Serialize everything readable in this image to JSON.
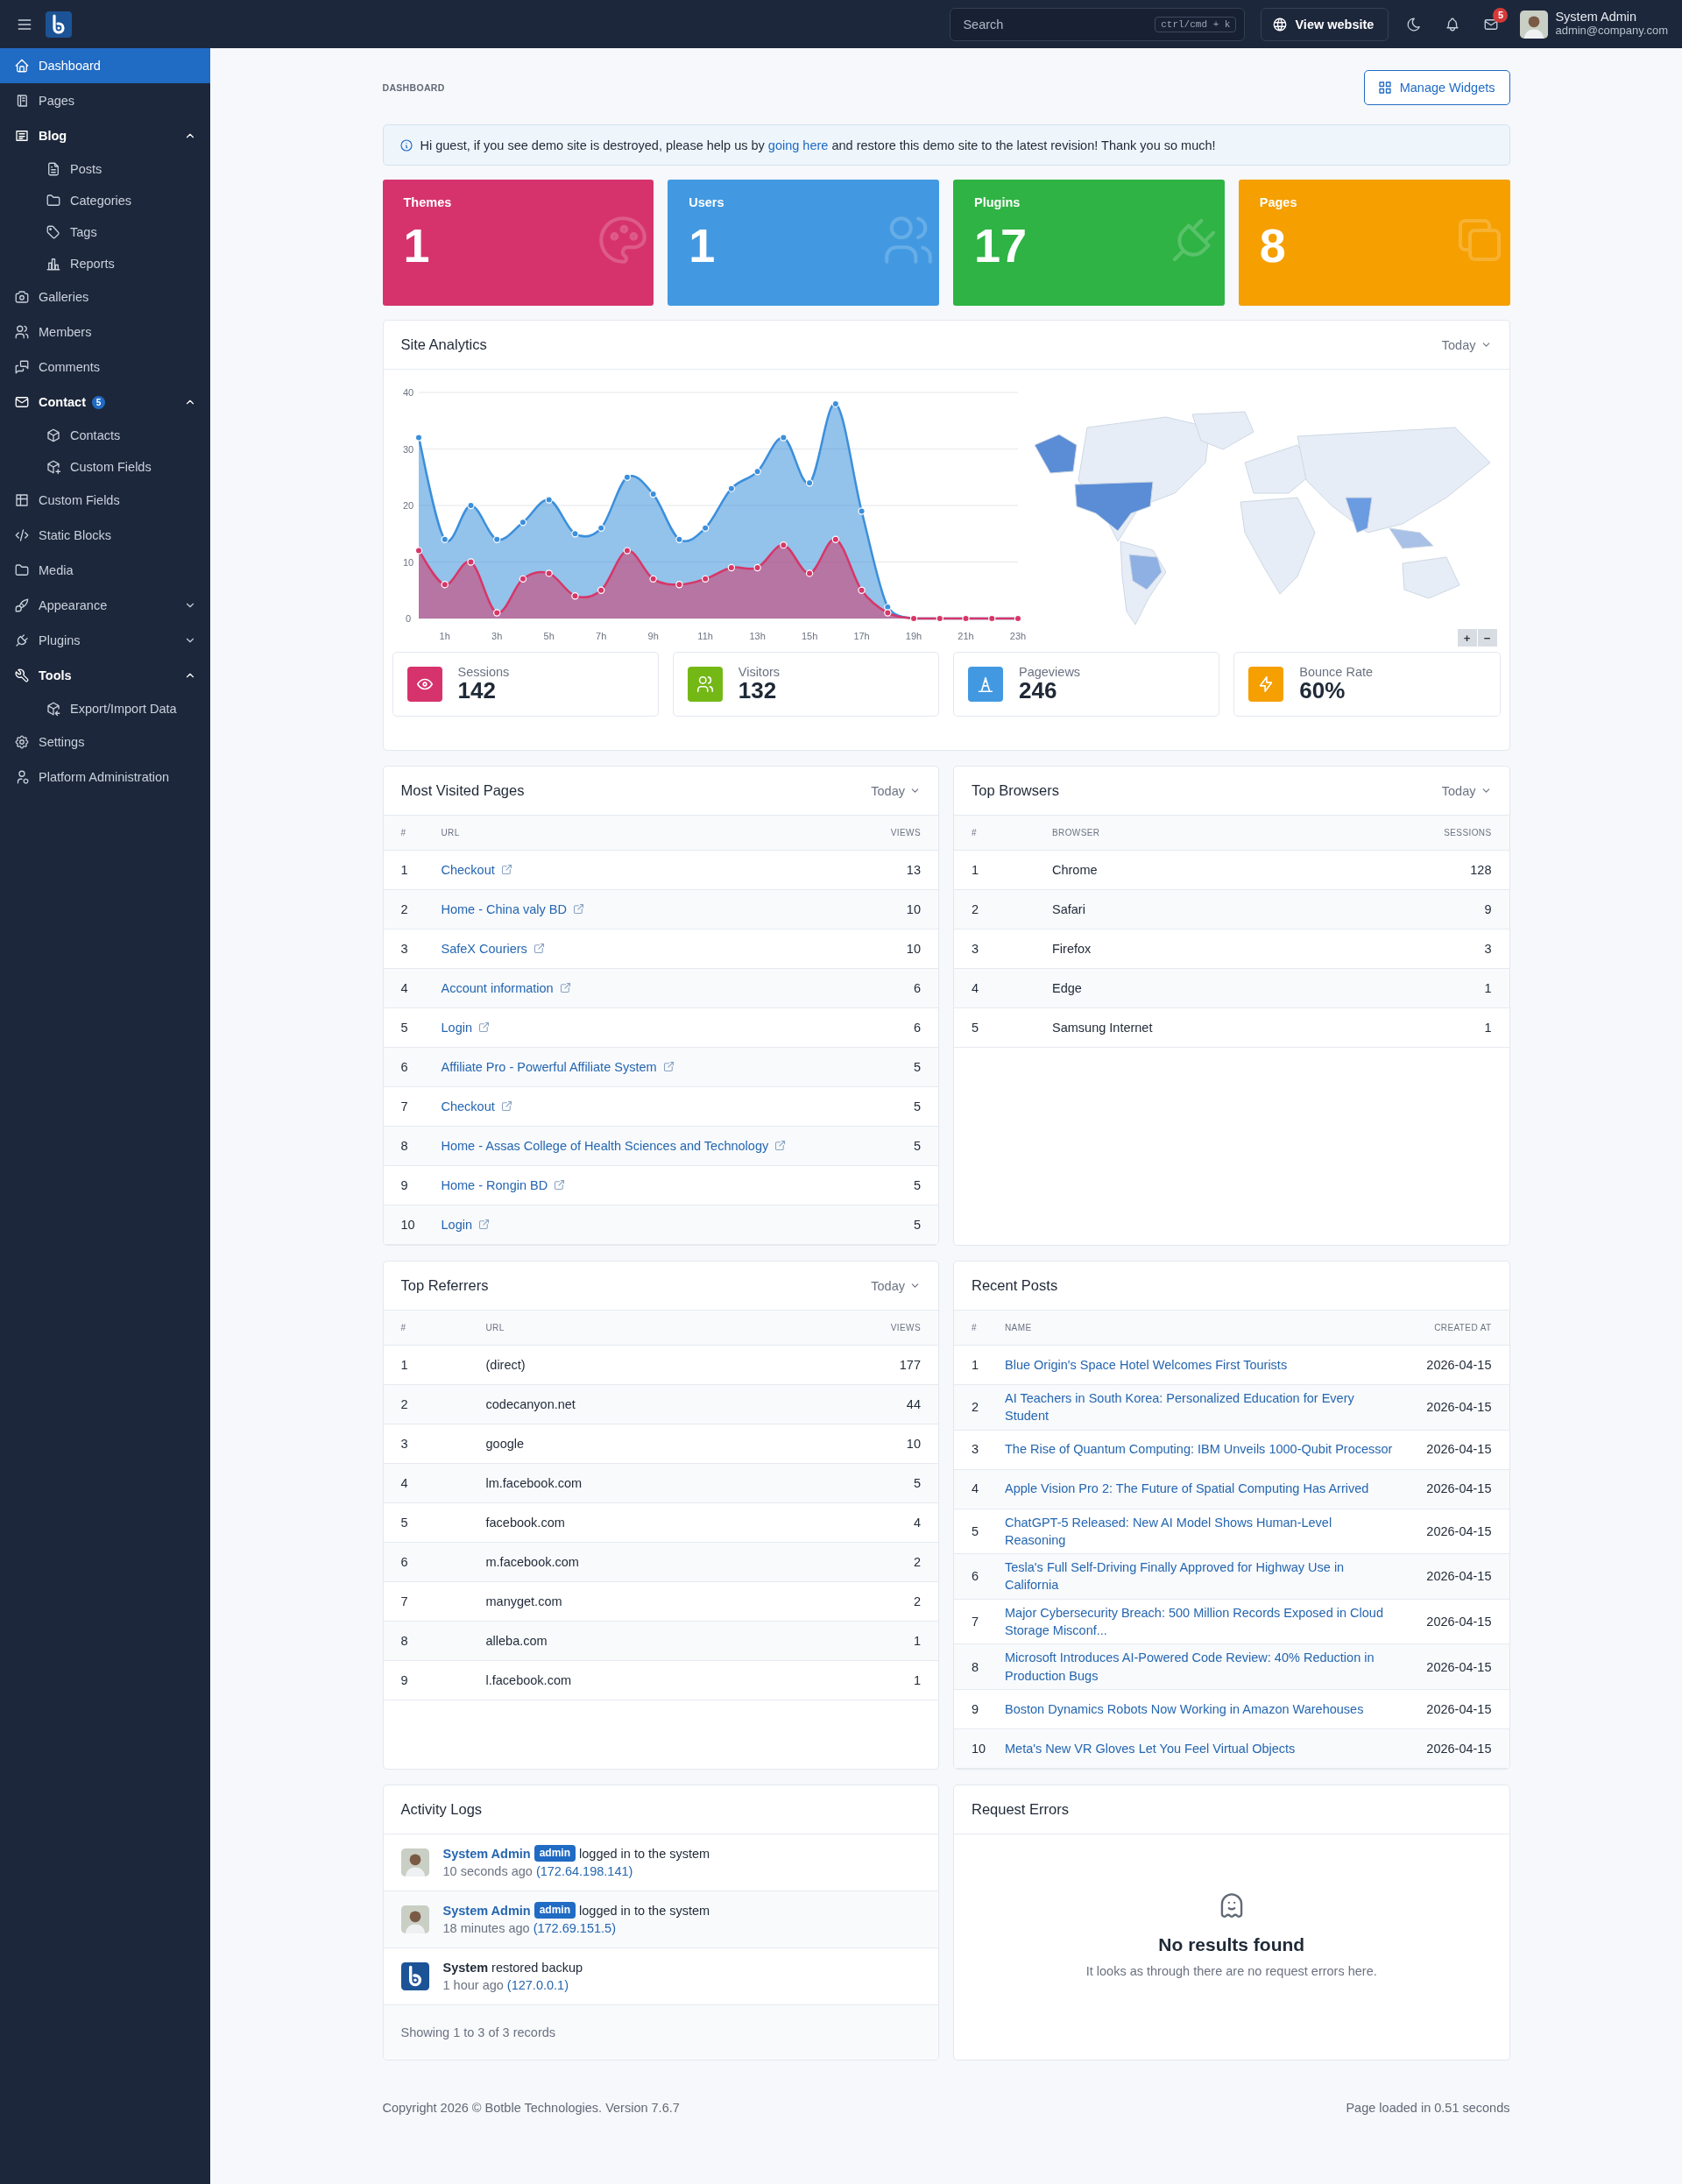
{
  "topbar": {
    "search": {
      "placeholder": "Search",
      "shortcut": "ctrl/cmd + k"
    },
    "view_website": "View website",
    "mail_badge": "5",
    "user": {
      "name": "System Admin",
      "email": "admin@company.com"
    }
  },
  "sidebar": {
    "items": [
      {
        "label": "Dashboard",
        "selected": true
      },
      {
        "label": "Pages",
        "selected": false
      },
      {
        "label": "Blog",
        "selected": false,
        "expanded": true,
        "children": [
          {
            "label": "Posts",
            "selected": false
          },
          {
            "label": "Categories",
            "selected": false
          },
          {
            "label": "Tags",
            "selected": false
          },
          {
            "label": "Reports",
            "selected": false
          }
        ]
      },
      {
        "label": "Galleries",
        "selected": false
      },
      {
        "label": "Members",
        "selected": false
      },
      {
        "label": "Comments",
        "selected": false
      },
      {
        "label": "Contact",
        "selected": false,
        "badge": "5",
        "expanded": true,
        "children": [
          {
            "label": "Contacts",
            "selected": false
          },
          {
            "label": "Custom Fields",
            "selected": false
          }
        ]
      },
      {
        "label": "Custom Fields",
        "selected": false
      },
      {
        "label": "Static Blocks",
        "selected": false
      },
      {
        "label": "Media",
        "selected": false
      },
      {
        "label": "Appearance",
        "selected": false,
        "expanded": false
      },
      {
        "label": "Plugins",
        "selected": false,
        "expanded": false
      },
      {
        "label": "Tools",
        "selected": false,
        "expanded": true,
        "children": [
          {
            "label": "Export/Import Data",
            "selected": false
          }
        ]
      },
      {
        "label": "Settings",
        "selected": false
      },
      {
        "label": "Platform Administration",
        "selected": false
      }
    ]
  },
  "page": {
    "breadcrumb": "DASHBOARD",
    "manage_widgets": "Manage Widgets"
  },
  "alert": {
    "before": "Hi guest, if you see demo site is destroyed, please help us by ",
    "link": "going here",
    "after": " and restore this demo site to the latest revision! Thank you so much!"
  },
  "stat_cards": [
    {
      "label": "Themes",
      "value": "1",
      "color": "#d6336c"
    },
    {
      "label": "Users",
      "value": "1",
      "color": "#4299e1"
    },
    {
      "label": "Plugins",
      "value": "17",
      "color": "#2fb344"
    },
    {
      "label": "Pages",
      "value": "8",
      "color": "#f59f00"
    }
  ],
  "site_analytics": {
    "title": "Site Analytics",
    "period": "Today",
    "chart_data": {
      "type": "area",
      "x": [
        0,
        1,
        2,
        3,
        4,
        5,
        6,
        7,
        8,
        9,
        10,
        11,
        12,
        13,
        14,
        15,
        16,
        17,
        18,
        19,
        20,
        21,
        22,
        23
      ],
      "xticks": [
        {
          "value": 1,
          "label": "1h"
        },
        {
          "value": 3,
          "label": "3h"
        },
        {
          "value": 5,
          "label": "5h"
        },
        {
          "value": 7,
          "label": "7h"
        },
        {
          "value": 9,
          "label": "9h"
        },
        {
          "value": 11,
          "label": "11h"
        },
        {
          "value": 13,
          "label": "13h"
        },
        {
          "value": 15,
          "label": "15h"
        },
        {
          "value": 17,
          "label": "17h"
        },
        {
          "value": 19,
          "label": "19h"
        },
        {
          "value": 21,
          "label": "21h"
        },
        {
          "value": 23,
          "label": "23h"
        }
      ],
      "xlim": [
        0,
        23
      ],
      "grid": true,
      "ylim": [
        0,
        40
      ],
      "yticks": [
        0,
        10,
        20,
        30,
        40
      ],
      "series": [
        {
          "color": "#3b8fdb",
          "values": [
            32,
            14,
            20,
            14,
            17,
            21,
            15,
            16,
            25,
            22,
            14,
            16,
            23,
            26,
            32,
            24,
            38,
            19,
            2,
            0,
            0,
            0,
            0,
            0
          ]
        },
        {
          "color": "#d63768",
          "values": [
            12,
            6,
            10,
            1,
            7,
            8,
            4,
            5,
            12,
            7,
            6,
            7,
            9,
            9,
            13,
            8,
            14,
            5,
            1,
            0,
            0,
            0,
            0,
            0
          ]
        }
      ]
    },
    "map": {
      "zoom_in": "+",
      "zoom_out": "−"
    },
    "metrics": [
      {
        "label": "Sessions",
        "value": "142",
        "color": "#d6336c"
      },
      {
        "label": "Visitors",
        "value": "132",
        "color": "#74b816"
      },
      {
        "label": "Pageviews",
        "value": "246",
        "color": "#4299e1"
      },
      {
        "label": "Bounce Rate",
        "value": "60%",
        "color": "#f59f00"
      }
    ]
  },
  "most_visited_pages": {
    "title": "Most Visited Pages",
    "period": "Today",
    "columns": [
      "#",
      "URL",
      "VIEWS"
    ],
    "rows": [
      {
        "rank": "1",
        "url": "Checkout",
        "views": "13"
      },
      {
        "rank": "2",
        "url": "Home - China valy BD",
        "views": "10"
      },
      {
        "rank": "3",
        "url": "SafeX Couriers",
        "views": "10"
      },
      {
        "rank": "4",
        "url": "Account information",
        "views": "6"
      },
      {
        "rank": "5",
        "url": "Login",
        "views": "6"
      },
      {
        "rank": "6",
        "url": "Affiliate Pro - Powerful Affiliate System",
        "views": "5"
      },
      {
        "rank": "7",
        "url": "Checkout",
        "views": "5"
      },
      {
        "rank": "8",
        "url": "Home - Assas College of Health Sciences and Technology",
        "views": "5"
      },
      {
        "rank": "9",
        "url": "Home - Rongin BD",
        "views": "5"
      },
      {
        "rank": "10",
        "url": "Login",
        "views": "5"
      }
    ]
  },
  "top_browsers": {
    "title": "Top Browsers",
    "period": "Today",
    "columns": [
      "#",
      "BROWSER",
      "SESSIONS"
    ],
    "rows": [
      {
        "rank": "1",
        "browser": "Chrome",
        "sessions": "128"
      },
      {
        "rank": "2",
        "browser": "Safari",
        "sessions": "9"
      },
      {
        "rank": "3",
        "browser": "Firefox",
        "sessions": "3"
      },
      {
        "rank": "4",
        "browser": "Edge",
        "sessions": "1"
      },
      {
        "rank": "5",
        "browser": "Samsung Internet",
        "sessions": "1"
      }
    ]
  },
  "top_referrers": {
    "title": "Top Referrers",
    "period": "Today",
    "columns": [
      "#",
      "URL",
      "VIEWS"
    ],
    "rows": [
      {
        "rank": "1",
        "url": "(direct)",
        "views": "177"
      },
      {
        "rank": "2",
        "url": "codecanyon.net",
        "views": "44"
      },
      {
        "rank": "3",
        "url": "google",
        "views": "10"
      },
      {
        "rank": "4",
        "url": "lm.facebook.com",
        "views": "5"
      },
      {
        "rank": "5",
        "url": "facebook.com",
        "views": "4"
      },
      {
        "rank": "6",
        "url": "m.facebook.com",
        "views": "2"
      },
      {
        "rank": "7",
        "url": "manyget.com",
        "views": "2"
      },
      {
        "rank": "8",
        "url": "alleba.com",
        "views": "1"
      },
      {
        "rank": "9",
        "url": "l.facebook.com",
        "views": "1"
      }
    ]
  },
  "recent_posts": {
    "title": "Recent Posts",
    "columns": [
      "#",
      "NAME",
      "CREATED AT"
    ],
    "rows": [
      {
        "rank": "1",
        "name": "Blue Origin's Space Hotel Welcomes First Tourists",
        "created_at": "2026-04-15"
      },
      {
        "rank": "2",
        "name": "AI Teachers in South Korea: Personalized Education for Every Student",
        "created_at": "2026-04-15"
      },
      {
        "rank": "3",
        "name": "The Rise of Quantum Computing: IBM Unveils 1000-Qubit Processor",
        "created_at": "2026-04-15"
      },
      {
        "rank": "4",
        "name": "Apple Vision Pro 2: The Future of Spatial Computing Has Arrived",
        "created_at": "2026-04-15"
      },
      {
        "rank": "5",
        "name": "ChatGPT-5 Released: New AI Model Shows Human-Level Reasoning",
        "created_at": "2026-04-15"
      },
      {
        "rank": "6",
        "name": "Tesla's Full Self-Driving Finally Approved for Highway Use in California",
        "created_at": "2026-04-15"
      },
      {
        "rank": "7",
        "name": "Major Cybersecurity Breach: 500 Million Records Exposed in Cloud Storage Misconf...",
        "created_at": "2026-04-15"
      },
      {
        "rank": "8",
        "name": "Microsoft Introduces AI-Powered Code Review: 40% Reduction in Production Bugs",
        "created_at": "2026-04-15"
      },
      {
        "rank": "9",
        "name": "Boston Dynamics Robots Now Working in Amazon Warehouses",
        "created_at": "2026-04-15"
      },
      {
        "rank": "10",
        "name": "Meta's New VR Gloves Let You Feel Virtual Objects",
        "created_at": "2026-04-15"
      }
    ]
  },
  "activity_logs": {
    "title": "Activity Logs",
    "entries": [
      {
        "kind": "user",
        "actor": "System Admin",
        "role": "admin",
        "action": "logged in to the system",
        "time": "10 seconds ago",
        "ip": "(172.64.198.141)"
      },
      {
        "kind": "user",
        "actor": "System Admin",
        "role": "admin",
        "action": "logged in to the system",
        "time": "18 minutes ago",
        "ip": "(172.69.151.5)"
      },
      {
        "kind": "system",
        "actor": "System",
        "action": "restored backup",
        "time": "1 hour ago",
        "ip": "(127.0.0.1)"
      }
    ],
    "footer": "Showing 1 to 3 of 3 records"
  },
  "request_errors": {
    "title": "Request Errors",
    "empty_title": "No results found",
    "empty_text": "It looks as through there are no request errors here."
  },
  "footer": {
    "copyright": "Copyright 2026 © Botble Technologies. Version 7.6.7",
    "load_time": "Page loaded in 0.51 seconds"
  }
}
